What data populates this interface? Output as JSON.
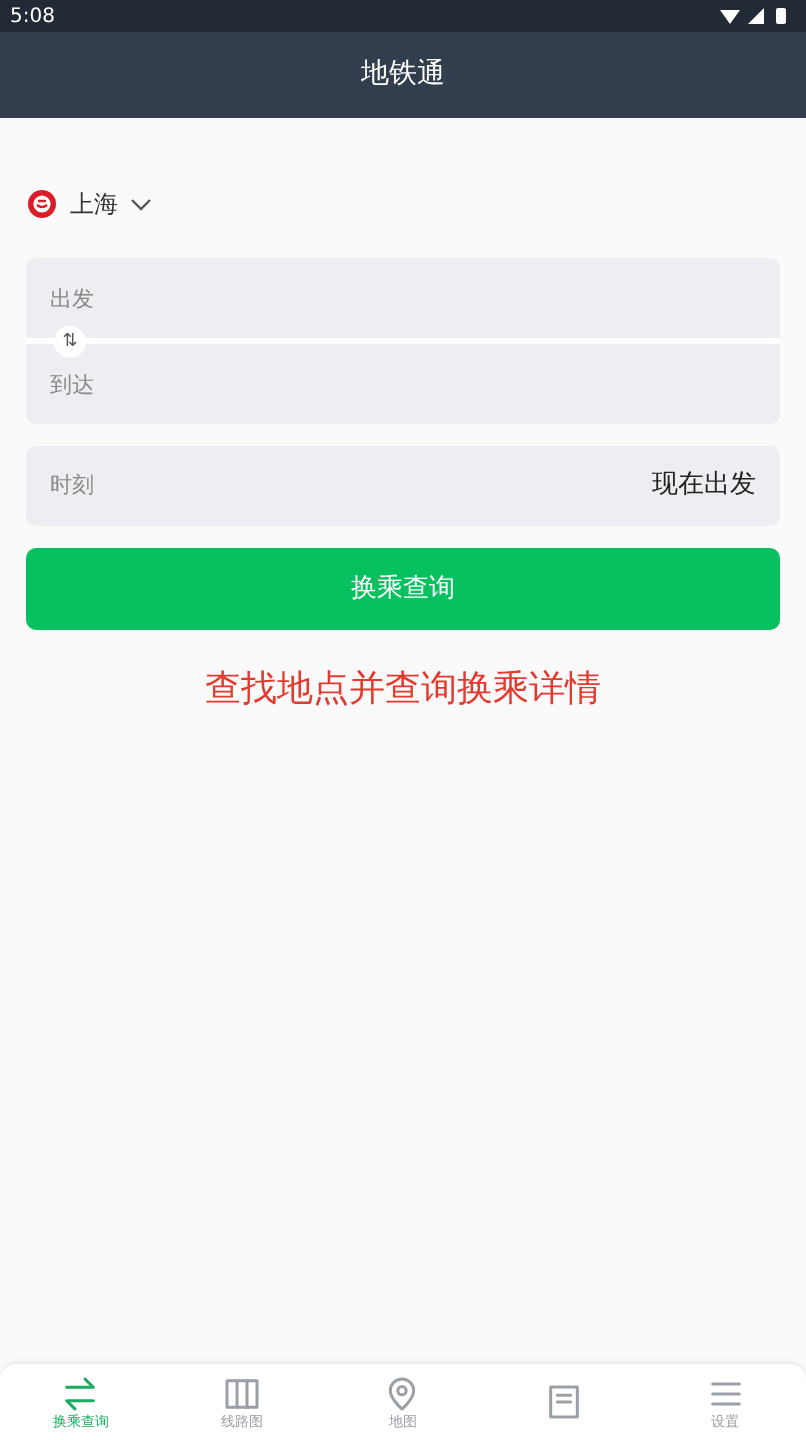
{
  "status_bar": {
    "time": "5:08"
  },
  "header": {
    "title": "地铁通"
  },
  "city": {
    "name": "上海"
  },
  "route": {
    "from_placeholder": "出发",
    "to_placeholder": "到达",
    "swap": "⇅"
  },
  "time_row": {
    "label": "时刻",
    "value": "现在出发"
  },
  "search_button": "换乘查询",
  "hint": "查找地点并查询换乘详情",
  "tabs": [
    {
      "kind": "transfer",
      "label": "换乘查询",
      "selected": true
    },
    {
      "kind": "lines",
      "label": "线路图",
      "selected": false
    },
    {
      "kind": "map",
      "label": "地图",
      "selected": false
    },
    {
      "kind": "notes",
      "selected": false
    },
    {
      "kind": "settings",
      "label": "设置",
      "selected": false
    }
  ]
}
